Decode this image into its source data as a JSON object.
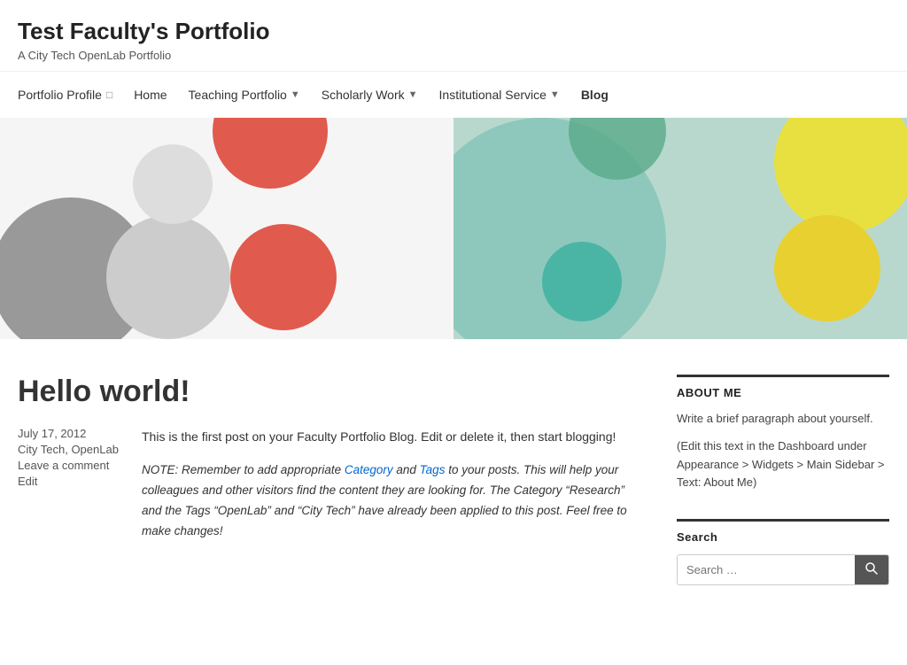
{
  "site": {
    "title": "Test Faculty's Portfolio",
    "description": "A City Tech OpenLab Portfolio"
  },
  "nav": {
    "items": [
      {
        "id": "portfolio-profile",
        "label": "Portfolio Profile",
        "hasIcon": true,
        "hasChevron": false,
        "active": false
      },
      {
        "id": "home",
        "label": "Home",
        "hasIcon": false,
        "hasChevron": false,
        "active": false
      },
      {
        "id": "teaching-portfolio",
        "label": "Teaching Portfolio",
        "hasIcon": false,
        "hasChevron": true,
        "active": false
      },
      {
        "id": "scholarly-work",
        "label": "Scholarly Work",
        "hasIcon": false,
        "hasChevron": true,
        "active": false
      },
      {
        "id": "institutional-service",
        "label": "Institutional Service",
        "hasIcon": false,
        "hasChevron": true,
        "active": false
      },
      {
        "id": "blog",
        "label": "Blog",
        "hasIcon": false,
        "hasChevron": false,
        "active": true
      }
    ]
  },
  "post": {
    "title": "Hello world!",
    "date": "July 17, 2012",
    "categories": "City Tech, OpenLab",
    "comments": "Leave a comment",
    "edit": "Edit",
    "intro": "This is the first post on your Faculty Portfolio Blog. Edit or delete it, then start blogging!",
    "note": "NOTE: Remember to add appropriate Category and Tags to your posts. This will help your colleagues and other visitors find the content they are looking for. The Category “Research” and the Tags “OpenLab” and “City Tech” have already been applied to this post. Feel free to make changes!",
    "category_link_text": "Category",
    "tags_link_text": "Tags"
  },
  "sidebar": {
    "about_title": "ABOUT ME",
    "about_text": "Write a brief paragraph about yourself.",
    "about_edit": "(Edit this text in the Dashboard under Appearance > Widgets > Main Sidebar > Text: About Me)",
    "search_title": "Search",
    "search_placeholder": "Search …",
    "search_button_label": "Search"
  }
}
